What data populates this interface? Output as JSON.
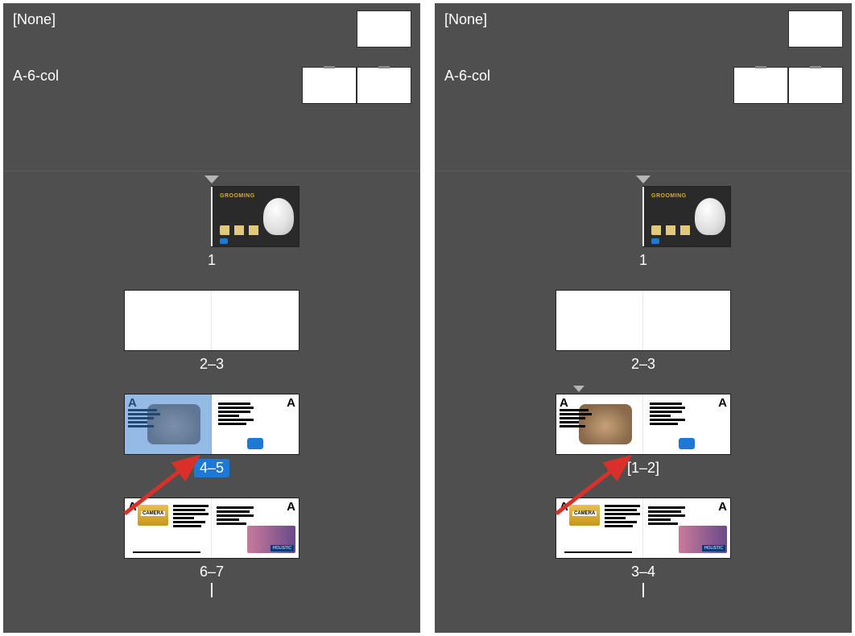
{
  "panels": [
    {
      "masters": [
        {
          "label": "[None]",
          "pages": 1
        },
        {
          "label": "A-6-col",
          "pages": 2
        }
      ],
      "spreads": [
        {
          "label": "1",
          "selected": false,
          "marker": "center",
          "pages": [
            {
              "art": "cover"
            }
          ]
        },
        {
          "label": "2–3",
          "selected": false,
          "pages": [
            {
              "art": "blank"
            },
            {
              "art": "blank"
            }
          ]
        },
        {
          "label": "4–5",
          "selected": true,
          "arrow": true,
          "pages": [
            {
              "art": "articleL",
              "badge": "A",
              "selected": true
            },
            {
              "art": "articleR",
              "badge": "A"
            }
          ]
        },
        {
          "label": "6–7",
          "selected": false,
          "pages": [
            {
              "art": "magL",
              "badge": "A"
            },
            {
              "art": "magR",
              "badge": "A"
            }
          ]
        }
      ]
    },
    {
      "masters": [
        {
          "label": "[None]",
          "pages": 1
        },
        {
          "label": "A-6-col",
          "pages": 2
        }
      ],
      "spreads": [
        {
          "label": "1",
          "selected": false,
          "marker": "center",
          "pages": [
            {
              "art": "cover"
            }
          ]
        },
        {
          "label": "2–3",
          "selected": false,
          "pages": [
            {
              "art": "blank"
            },
            {
              "art": "blank"
            }
          ]
        },
        {
          "label": "[1–2]",
          "selected": false,
          "arrow": true,
          "marker": "left",
          "pages": [
            {
              "art": "articleL",
              "badge": "A"
            },
            {
              "art": "articleR",
              "badge": "A"
            }
          ]
        },
        {
          "label": "3–4",
          "selected": false,
          "pages": [
            {
              "art": "magL",
              "badge": "A"
            },
            {
              "art": "magR",
              "badge": "A"
            }
          ]
        }
      ]
    }
  ],
  "icons": {
    "master_badge": "A"
  }
}
